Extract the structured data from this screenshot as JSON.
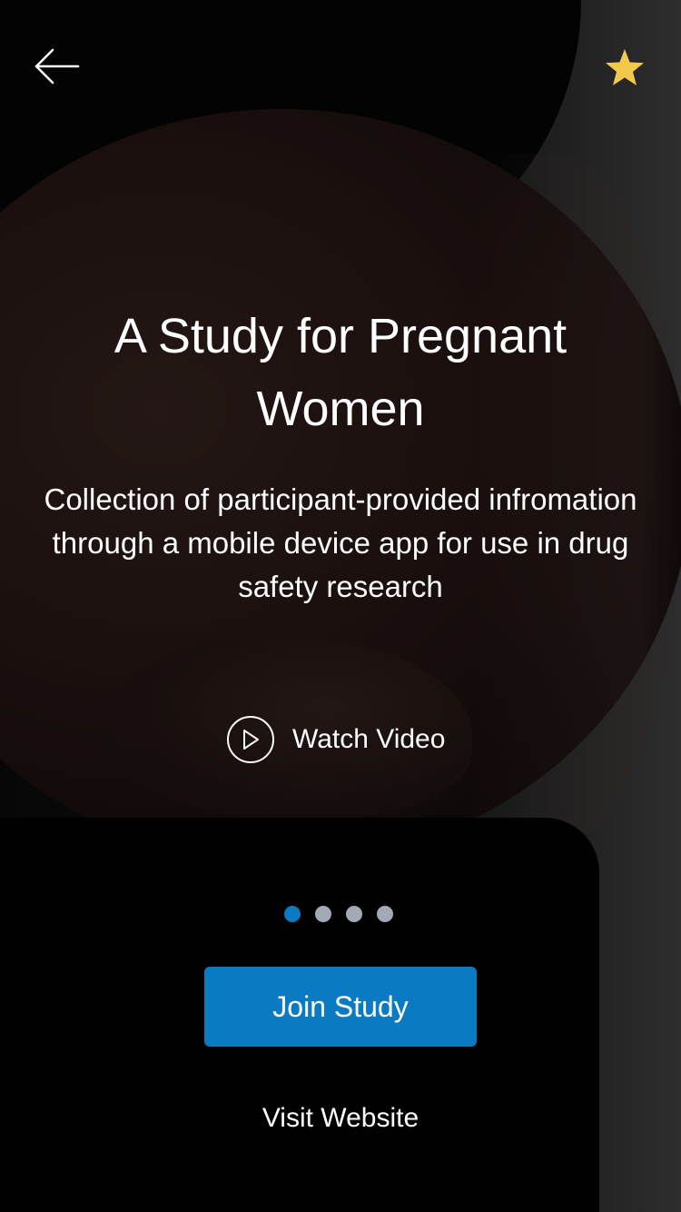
{
  "header": {
    "back_icon": "arrow-left-icon",
    "favorite_icon": "star-icon",
    "favorite_color": "#F2C94C"
  },
  "hero": {
    "title": "A Study for Pregnant Women",
    "description": "Collection of participant-provided infromation through a mobile device app for use in drug safety research"
  },
  "video": {
    "icon": "play-circle-icon",
    "label": "Watch Video"
  },
  "pager": {
    "total_pages": 4,
    "active_index": 0,
    "active_color": "#0A7AC3",
    "inactive_color": "#A3A9B5"
  },
  "actions": {
    "join_label": "Join Study",
    "join_color": "#0A7AC3",
    "visit_label": "Visit Website"
  }
}
